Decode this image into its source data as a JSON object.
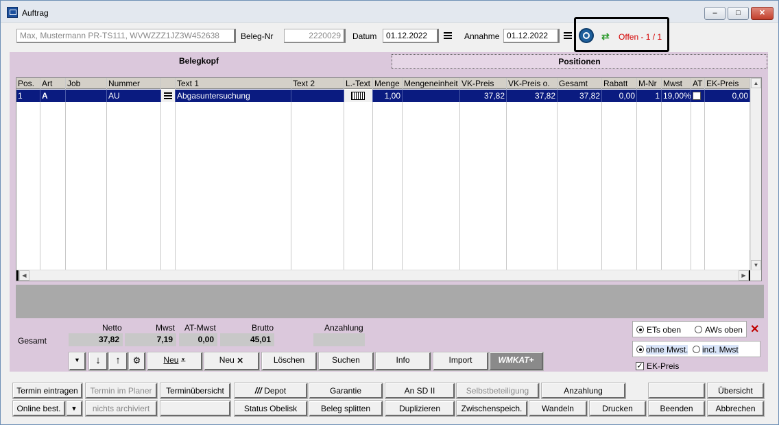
{
  "window": {
    "title": "Auftrag",
    "min": "‒",
    "max": "□",
    "close": "✕"
  },
  "header": {
    "customer": "Max, Mustermann PR-TS111, WVWZZZ1JZ3W452638",
    "beleg_label": "Beleg-Nr",
    "beleg_value": "2220029",
    "datum_label": "Datum",
    "datum_value": "01.12.2022",
    "annahme_label": "Annahme",
    "annahme_value": "01.12.2022",
    "status": "Offen - 1 / 1",
    "status_color": "#d40000",
    "highlight_color": "#000000"
  },
  "tabs": [
    {
      "label": "Belegkopf"
    },
    {
      "label": "Positionen"
    }
  ],
  "table": {
    "columns": [
      "Pos.",
      "Art",
      "Job",
      "Nummer",
      "",
      "Text 1",
      "Text 2",
      "L.-Text",
      "Menge",
      "Mengeneinheit",
      "VK-Preis",
      "VK-Preis o.",
      "Gesamt",
      "Rabatt",
      "M-Nr",
      "Mwst",
      "AT",
      "EK-Preis"
    ],
    "rows": [
      {
        "pos": "1",
        "art": "A",
        "job": "",
        "nummer": "AU",
        "text1": "Abgasuntersuchung",
        "text2": "",
        "menge": "1,00",
        "einheit": "",
        "vk": "37,82",
        "vko": "37,82",
        "gesamt": "37,82",
        "rabatt": "0,00",
        "mnr": "1",
        "mwst": "19,00%",
        "ek": "0,00"
      }
    ],
    "selection_color": "#0a1b80"
  },
  "totals": {
    "gesamt_label": "Gesamt",
    "netto_label": "Netto",
    "netto": "37,82",
    "mwst_label": "Mwst",
    "mwst": "7,19",
    "atmwst_label": "AT-Mwst",
    "atmwst": "0,00",
    "brutto_label": "Brutto",
    "brutto": "45,01",
    "anzahlung_label": "Anzahlung",
    "anzahlung": ""
  },
  "actions": {
    "neu1": "Neu",
    "neu2": "Neu",
    "loeschen": "Löschen",
    "suchen": "Suchen",
    "info": "Info",
    "import": "Import",
    "wmkat": "WMKAT+"
  },
  "options": {
    "ets_oben": "ETs oben",
    "aws_oben": "AWs oben",
    "ohne_mwst": "ohne Mwst.",
    "incl_mwst": "incl. Mwst",
    "ek_preis": "EK-Preis"
  },
  "bottom_row1": [
    "Termin eintragen",
    "Termin im Planer",
    "Terminübersicht",
    "Depot",
    "Garantie",
    "An SD II",
    "Selbstbeteiligung",
    "Anzahlung",
    "",
    "Übersicht"
  ],
  "bottom_row2": [
    "Online best.",
    "nichts archiviert",
    "",
    "Status Obelisk",
    "Beleg splitten",
    "Duplizieren",
    "Zwischenspeich.",
    "Wandeln",
    "Drucken",
    "Beenden",
    "Abbrechen"
  ],
  "panel_color": "#dbc8dc"
}
